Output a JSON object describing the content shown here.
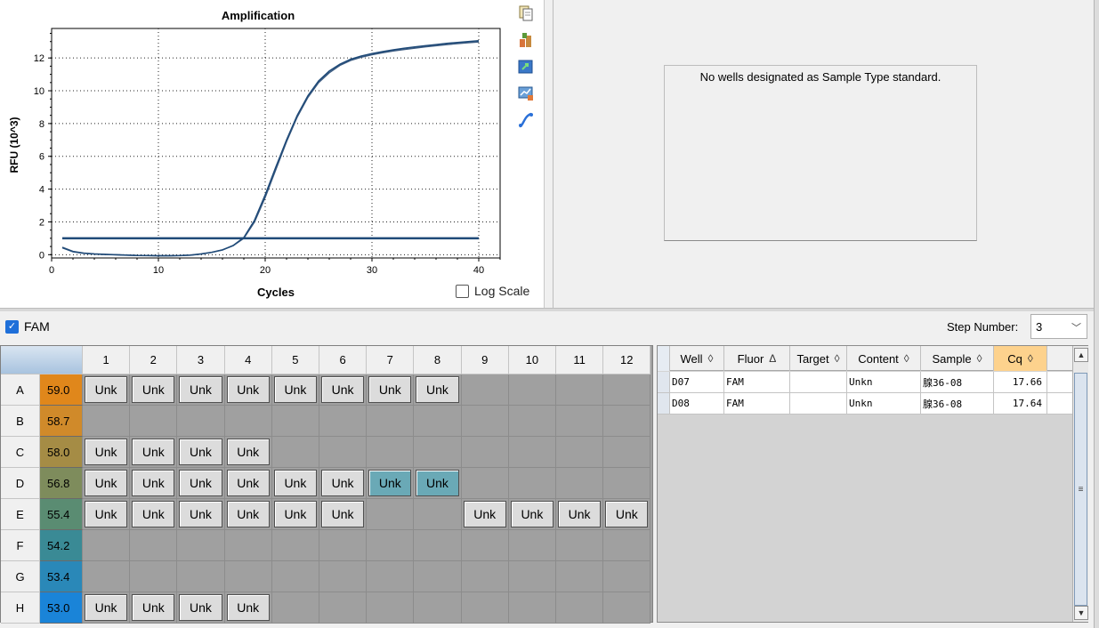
{
  "chart_data": {
    "type": "line",
    "title": "Amplification",
    "xlabel": "Cycles",
    "ylabel": "RFU (10^3)",
    "xlim": [
      0,
      42
    ],
    "ylim": [
      -0.2,
      13.8
    ],
    "x_ticks": [
      0,
      10,
      20,
      30,
      40
    ],
    "y_ticks": [
      0,
      2,
      4,
      6,
      8,
      10,
      12
    ],
    "grid": true,
    "series": [
      {
        "x": [
          1,
          2,
          3,
          4,
          5,
          6,
          7,
          8,
          9,
          10,
          11,
          12,
          13,
          14,
          15,
          16,
          17,
          18,
          19,
          20,
          21,
          22,
          23,
          24,
          25,
          26,
          27,
          28,
          29,
          30,
          31,
          32,
          33,
          34,
          35,
          36,
          37,
          38,
          39,
          40
        ],
        "y": [
          0.45,
          0.2,
          0.1,
          0.05,
          0.02,
          0.0,
          -0.02,
          -0.04,
          -0.05,
          -0.06,
          -0.06,
          -0.05,
          -0.02,
          0.05,
          0.15,
          0.3,
          0.55,
          1.0,
          2.0,
          3.5,
          5.2,
          6.9,
          8.4,
          9.6,
          10.5,
          11.1,
          11.55,
          11.85,
          12.05,
          12.2,
          12.32,
          12.43,
          12.52,
          12.6,
          12.68,
          12.75,
          12.82,
          12.88,
          12.93,
          12.98
        ],
        "color": "#3a5a80"
      },
      {
        "x": [
          1,
          2,
          3,
          4,
          5,
          6,
          7,
          8,
          9,
          10,
          11,
          12,
          13,
          14,
          15,
          16,
          17,
          18,
          19,
          20,
          21,
          22,
          23,
          24,
          25,
          26,
          27,
          28,
          29,
          30,
          31,
          32,
          33,
          34,
          35,
          36,
          37,
          38,
          39,
          40
        ],
        "y": [
          0.42,
          0.18,
          0.08,
          0.04,
          0.01,
          -0.01,
          -0.03,
          -0.05,
          -0.06,
          -0.07,
          -0.07,
          -0.06,
          -0.03,
          0.04,
          0.14,
          0.29,
          0.56,
          1.05,
          2.1,
          3.65,
          5.35,
          7.0,
          8.5,
          9.7,
          10.6,
          11.2,
          11.62,
          11.92,
          12.12,
          12.27,
          12.39,
          12.5,
          12.59,
          12.67,
          12.75,
          12.82,
          12.89,
          12.95,
          13.0,
          13.05
        ],
        "color": "#1f4a78"
      }
    ],
    "threshold": 1.0
  },
  "chart_toolbar": {
    "icons": [
      "copy-icon",
      "export-icon",
      "export-arrow-icon",
      "chart-settings-icon",
      "curve-icon"
    ]
  },
  "log_scale": {
    "label": "Log Scale",
    "checked": false
  },
  "standard_curve": {
    "message": "No wells designated as Sample Type standard."
  },
  "fluor_filter": {
    "label": "FAM",
    "checked": true
  },
  "step": {
    "label": "Step Number:",
    "value": "3"
  },
  "plate": {
    "columns": [
      "1",
      "2",
      "3",
      "4",
      "5",
      "6",
      "7",
      "8",
      "9",
      "10",
      "11",
      "12"
    ],
    "rows": [
      {
        "label": "A",
        "temp": "59.0",
        "color": "#e0871b",
        "wells": [
          "Unk",
          "Unk",
          "Unk",
          "Unk",
          "Unk",
          "Unk",
          "Unk",
          "Unk",
          "",
          "",
          "",
          ""
        ]
      },
      {
        "label": "B",
        "temp": "58.7",
        "color": "#d08a2a",
        "wells": [
          "",
          "",
          "",
          "",
          "",
          "",
          "",
          "",
          "",
          "",
          "",
          ""
        ]
      },
      {
        "label": "C",
        "temp": "58.0",
        "color": "#a58c45",
        "wells": [
          "Unk",
          "Unk",
          "Unk",
          "Unk",
          "",
          "",
          "",
          "",
          "",
          "",
          "",
          ""
        ]
      },
      {
        "label": "D",
        "temp": "56.8",
        "color": "#7e8c5c",
        "wells": [
          "Unk",
          "Unk",
          "Unk",
          "Unk",
          "Unk",
          "Unk",
          "Unk",
          "Unk",
          "",
          "",
          "",
          ""
        ]
      },
      {
        "label": "E",
        "temp": "55.4",
        "color": "#5a8c72",
        "wells": [
          "Unk",
          "Unk",
          "Unk",
          "Unk",
          "Unk",
          "Unk",
          "",
          "",
          "Unk",
          "Unk",
          "Unk",
          "Unk"
        ]
      },
      {
        "label": "F",
        "temp": "54.2",
        "color": "#3a8a95",
        "wells": [
          "",
          "",
          "",
          "",
          "",
          "",
          "",
          "",
          "",
          "",
          "",
          ""
        ]
      },
      {
        "label": "G",
        "temp": "53.4",
        "color": "#2a88b8",
        "wells": [
          "",
          "",
          "",
          "",
          "",
          "",
          "",
          "",
          "",
          "",
          "",
          ""
        ]
      },
      {
        "label": "H",
        "temp": "53.0",
        "color": "#1a84d8",
        "wells": [
          "Unk",
          "Unk",
          "Unk",
          "Unk",
          "",
          "",
          "",
          "",
          "",
          "",
          "",
          ""
        ]
      }
    ],
    "selected": [
      "D7",
      "D8"
    ]
  },
  "results_table": {
    "headers": [
      {
        "label": "Well",
        "sort": "◊"
      },
      {
        "label": "Fluor",
        "sort": "Δ"
      },
      {
        "label": "Target",
        "sort": "◊"
      },
      {
        "label": "Content",
        "sort": "◊"
      },
      {
        "label": "Sample",
        "sort": "◊"
      },
      {
        "label": "Cq",
        "sort": "◊"
      }
    ],
    "rows": [
      [
        "D07",
        "FAM",
        "",
        "Unkn",
        "腺36-08",
        "17.66"
      ],
      [
        "D08",
        "FAM",
        "",
        "Unkn",
        "腺36-08",
        "17.64"
      ]
    ]
  }
}
